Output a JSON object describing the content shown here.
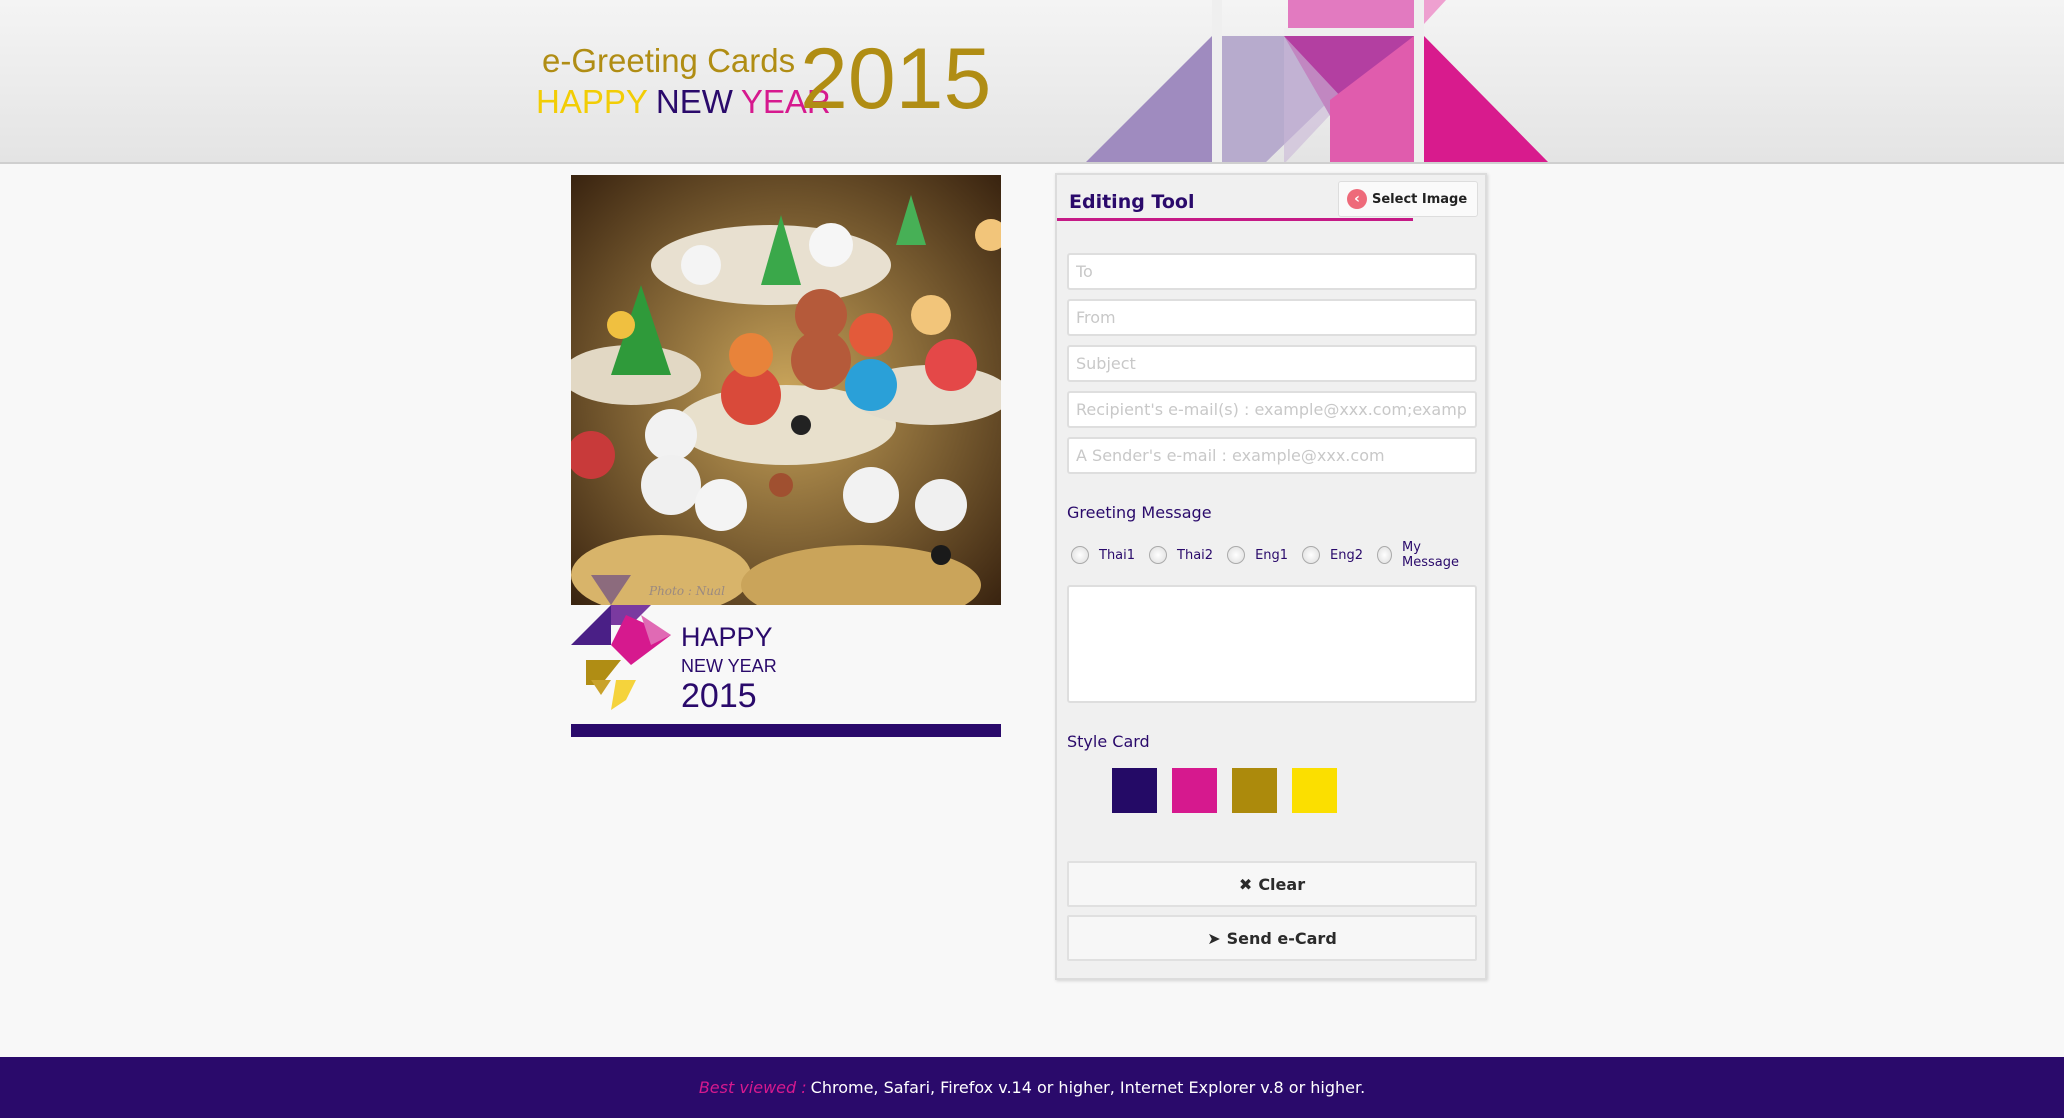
{
  "header": {
    "logo_egreet": "e-Greeting Cards",
    "logo_happy": "HAPPY",
    "logo_new": "NEW",
    "logo_year": "YEAR",
    "logo_number": "2015"
  },
  "card": {
    "photo_watermark": "Photo : Nual",
    "badge_happy": "HAPPY",
    "badge_newyear": "NEW YEAR",
    "badge_number": "2015"
  },
  "editor": {
    "title": "Editing Tool",
    "select_image_label": "Select Image",
    "fields": {
      "to_placeholder": "To",
      "from_placeholder": "From",
      "subject_placeholder": "Subject",
      "recipient_placeholder": "Recipient's e-mail(s) : example@xxx.com;example@xxx.com",
      "sender_placeholder": "A Sender's e-mail : example@xxx.com"
    },
    "greeting_label": "Greeting Message",
    "greeting_options": [
      "Thai1",
      "Thai2",
      "Eng1",
      "Eng2",
      "My Message"
    ],
    "style_label": "Style Card",
    "style_colors": [
      "#240a66",
      "#d6198e",
      "#ac8a0c",
      "#fbdf00"
    ],
    "clear_label": "Clear",
    "send_label": "Send e-Card"
  },
  "footer": {
    "best_viewed": "Best viewed :",
    "browsers": "Chrome, Safari, Firefox v.14 or higher, Internet Explorer v.8 or higher."
  }
}
